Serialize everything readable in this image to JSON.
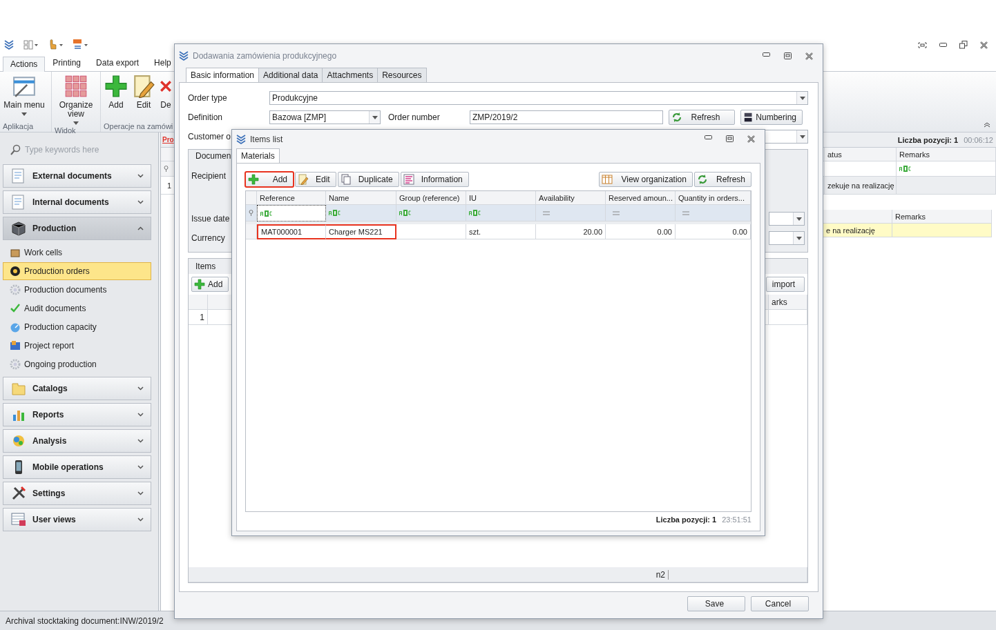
{
  "ribbon": {
    "tabs": [
      {
        "label": "Actions",
        "selected": true
      },
      {
        "label": "Printing",
        "selected": false
      },
      {
        "label": "Data export",
        "selected": false
      },
      {
        "label": "Help",
        "selected": false
      }
    ],
    "groups": [
      {
        "label": "Aplikacja",
        "buttons": [
          {
            "label": "Main menu",
            "kind": "menu",
            "dropdown": true
          }
        ]
      },
      {
        "label": "Widok",
        "buttons": [
          {
            "label": "Organize view",
            "kind": "grid",
            "dropdown": true
          }
        ]
      },
      {
        "label": "Operacje na zamówi",
        "buttons": [
          {
            "label": "Add",
            "kind": "add",
            "dropdown": false
          },
          {
            "label": "Edit",
            "kind": "edit",
            "dropdown": false
          },
          {
            "label": "De",
            "kind": "delete",
            "dropdown": false
          }
        ]
      }
    ]
  },
  "sidebar": {
    "search_placeholder": "Type keywords here",
    "groups": [
      {
        "label": "External documents",
        "kind": "doc",
        "expanded": false
      },
      {
        "label": "Internal documents",
        "kind": "doc",
        "expanded": false
      },
      {
        "label": "Production",
        "kind": "box",
        "expanded": true,
        "items": [
          {
            "label": "Work cells",
            "kind": "cell",
            "selected": false
          },
          {
            "label": "Production orders",
            "kind": "order",
            "selected": true
          },
          {
            "label": "Production documents",
            "kind": "gear",
            "selected": false
          },
          {
            "label": "Audit documents",
            "kind": "check",
            "selected": false
          },
          {
            "label": "Production capacity",
            "kind": "gauge",
            "selected": false
          },
          {
            "label": "Project report",
            "kind": "report",
            "selected": false
          },
          {
            "label": "Ongoing production",
            "kind": "gear",
            "selected": false
          }
        ]
      },
      {
        "label": "Catalogs",
        "kind": "folder",
        "expanded": false
      },
      {
        "label": "Reports",
        "kind": "chart",
        "expanded": false
      },
      {
        "label": "Analysis",
        "kind": "analysis",
        "expanded": false
      },
      {
        "label": "Mobile operations",
        "kind": "phone",
        "expanded": false
      },
      {
        "label": "Settings",
        "kind": "tools",
        "expanded": false
      },
      {
        "label": "User views",
        "kind": "views",
        "expanded": false
      }
    ]
  },
  "main_list": {
    "tab": "Pro",
    "count_label": "Liczba pozycji: 1",
    "time": "00:06:12",
    "columns": [
      "atus",
      "Remarks"
    ],
    "row_number": "1",
    "group_row": "zekuje na realizację",
    "detail_column": "Remarks",
    "detail_row": "e na realizację"
  },
  "dialog": {
    "title": "Dodawania zamówienia produkcyjnego",
    "tabs": [
      {
        "label": "Basic information",
        "selected": true
      },
      {
        "label": "Additional data",
        "selected": false
      },
      {
        "label": "Attachments",
        "selected": false
      },
      {
        "label": "Resources",
        "selected": false
      }
    ],
    "order_type": {
      "label": "Order type",
      "value": "Produkcyjne"
    },
    "definition": {
      "label": "Definition",
      "value": "Bazowa [ZMP]"
    },
    "order_number": {
      "label": "Order number",
      "value": "ZMP/2019/2"
    },
    "refresh_button": "Refresh",
    "numbering_button": "Numbering",
    "customer_label": "Customer o",
    "document_group": {
      "title": "Documen",
      "recipient_label": "Recipient",
      "issue_date_label": "Issue date",
      "currency_label": "Currency"
    },
    "items_group": {
      "title": "Items",
      "add_button": "Add",
      "import_button": "import",
      "column": "arks",
      "row_number": "1",
      "footer": "n2"
    },
    "buttons": [
      "Save",
      "Cancel"
    ]
  },
  "items_dialog": {
    "title": "Items list",
    "tabs": [
      {
        "label": "Materials",
        "selected": true
      }
    ],
    "toolbar": [
      {
        "label": "Add",
        "kind": "add",
        "highlighted": true
      },
      {
        "label": "Edit",
        "kind": "edit",
        "highlighted": false
      },
      {
        "label": "Duplicate",
        "kind": "duplicate",
        "highlighted": false
      },
      {
        "label": "Information",
        "kind": "info",
        "highlighted": false
      }
    ],
    "toolbar_right": [
      {
        "label": "View organization",
        "kind": "columns"
      },
      {
        "label": "Refresh",
        "kind": "refresh"
      }
    ],
    "columns": [
      {
        "label": "Reference",
        "kind": "text"
      },
      {
        "label": "Name",
        "kind": "text"
      },
      {
        "label": "Group (reference)",
        "kind": "text"
      },
      {
        "label": "IU",
        "kind": "text"
      },
      {
        "label": "Availability",
        "kind": "number"
      },
      {
        "label": "Reserved amoun...",
        "kind": "number"
      },
      {
        "label": "Quantity in orders...",
        "kind": "number"
      }
    ],
    "rows": [
      {
        "cells": [
          {
            "text": "MAT000001",
            "highlighted": true
          },
          {
            "text": "Charger MS221",
            "highlighted": true
          },
          {
            "highlighted": false
          },
          {
            "text": "szt.",
            "highlighted": false
          },
          {
            "text": "20.00",
            "highlighted": false
          },
          {
            "text": "0.00",
            "highlighted": false
          },
          {
            "text": "0.00",
            "highlighted": false
          }
        ]
      }
    ],
    "count_label": "Liczba pozycji: 1",
    "time": "23:51:51"
  },
  "status_bar": "Archival stocktaking document:INW/2019/2"
}
